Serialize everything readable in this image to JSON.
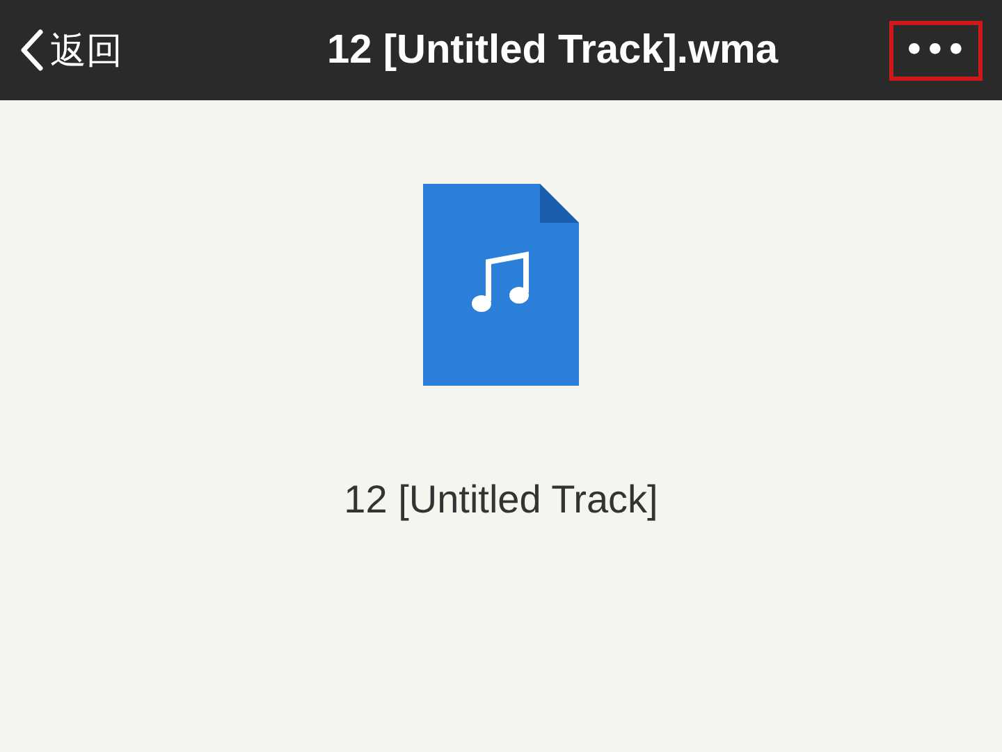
{
  "header": {
    "back_label": "返回",
    "title": "12 [Untitled Track].wma",
    "more": {
      "label": "•••",
      "highlighted": true
    }
  },
  "file": {
    "name": "12 [Untitled Track]"
  }
}
